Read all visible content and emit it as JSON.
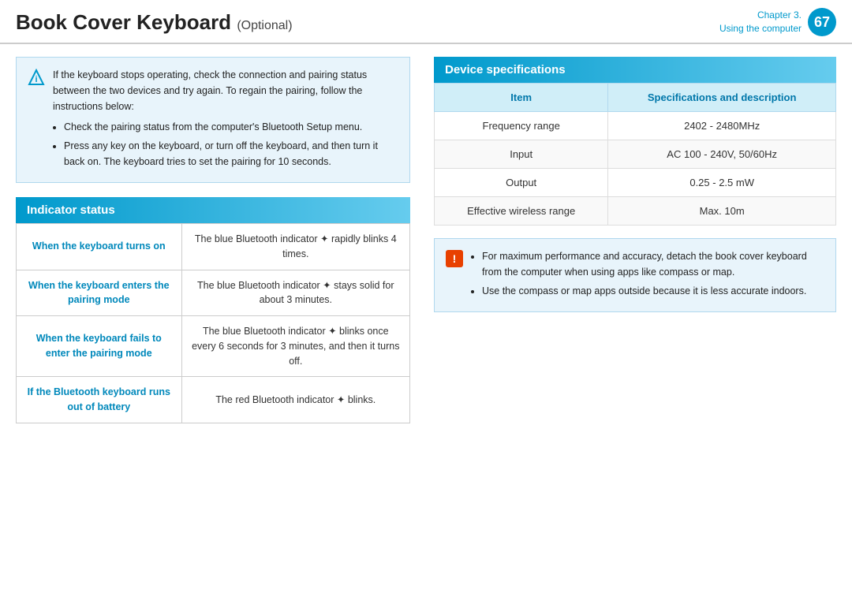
{
  "header": {
    "title": "Book Cover Keyboard",
    "optional_label": "(Optional)",
    "chapter_label": "Chapter 3.",
    "chapter_sub": "Using the computer",
    "page_number": "67"
  },
  "info_box": {
    "text": "If the keyboard stops operating, check the connection and pairing status between the two devices and try again. To regain the pairing, follow the instructions below:",
    "bullets": [
      "Check the pairing status from the computer's Bluetooth Setup menu.",
      "Press any key on the keyboard, or turn off the keyboard, and then turn it back on. The keyboard tries to set the pairing for 10 seconds."
    ]
  },
  "indicator_status": {
    "section_title": "Indicator status",
    "rows": [
      {
        "condition": "When the keyboard turns on",
        "description": "The blue Bluetooth indicator ✦ rapidly blinks 4 times."
      },
      {
        "condition": "When the keyboard enters the pairing mode",
        "description": "The blue Bluetooth indicator ✦ stays solid for about 3 minutes."
      },
      {
        "condition": "When the keyboard fails to enter the pairing mode",
        "description": "The blue Bluetooth indicator ✦ blinks once every 6 seconds for 3 minutes, and then it turns off."
      },
      {
        "condition": "If the Bluetooth keyboard runs out of battery",
        "description": "The red Bluetooth indicator ✦ blinks."
      }
    ]
  },
  "device_specs": {
    "section_title": "Device specifications",
    "table_headers": [
      "Item",
      "Specifications and description"
    ],
    "rows": [
      {
        "item": "Frequency range",
        "spec": "2402 - 2480MHz"
      },
      {
        "item": "Input",
        "spec": "AC 100 - 240V, 50/60Hz"
      },
      {
        "item": "Output",
        "spec": "0.25 - 2.5 mW"
      },
      {
        "item": "Effective wireless range",
        "spec": "Max. 10m"
      }
    ]
  },
  "note_box": {
    "icon": "!",
    "bullets": [
      "For maximum performance and accuracy, detach the book cover keyboard from the computer when using apps like compass or map.",
      "Use the compass or map apps outside because it is less accurate indoors."
    ]
  }
}
